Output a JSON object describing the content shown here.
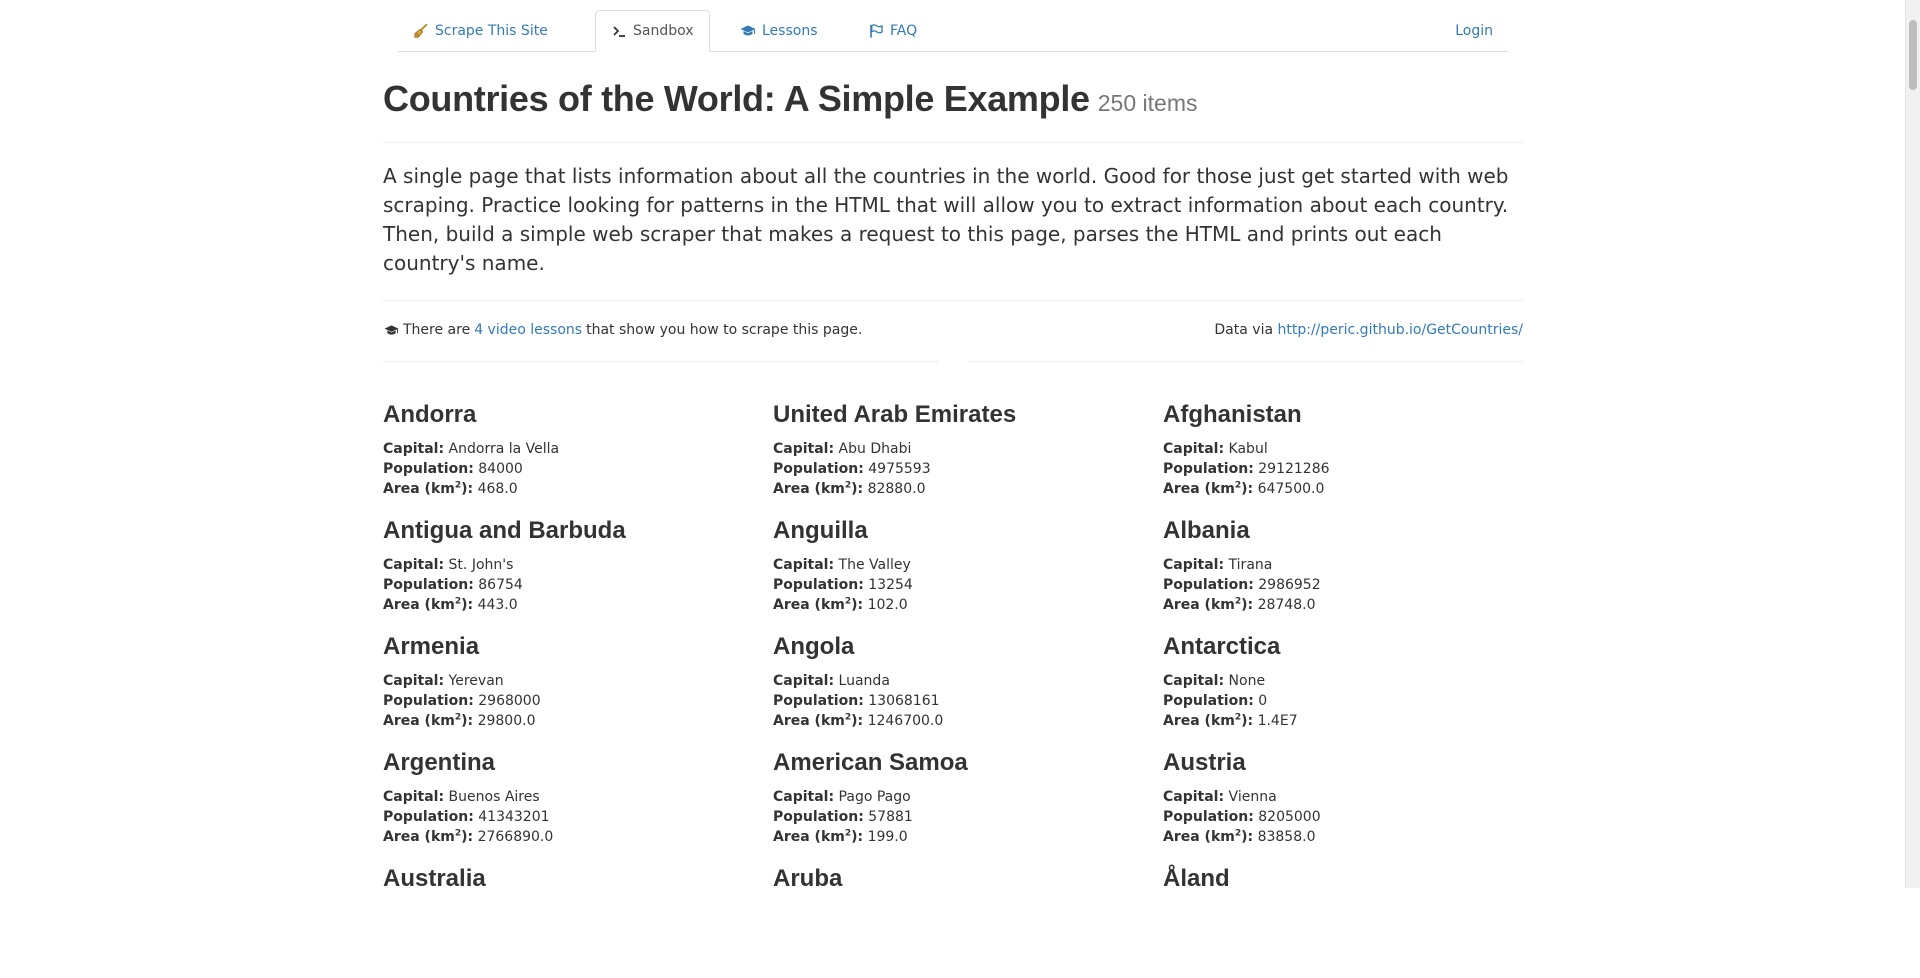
{
  "nav": {
    "tabs": [
      {
        "label": "Scrape This Site",
        "icon": "broom-icon"
      },
      {
        "label": "Sandbox",
        "icon": "terminal-icon"
      },
      {
        "label": "Lessons",
        "icon": "graduation-cap-icon"
      },
      {
        "label": "FAQ",
        "icon": "flag-icon"
      }
    ],
    "login": "Login"
  },
  "header": {
    "title": "Countries of the World: A Simple Example",
    "count": "250 items"
  },
  "lead": "A single page that lists information about all the countries in the world. Good for those just get started with web scraping. Practice looking for patterns in the HTML that will allow you to extract information about each country. Then, build a simple web scraper that makes a request to this page, parses the HTML and prints out each country's name.",
  "info": {
    "prefix": "There are",
    "link": "4 video lessons",
    "suffix": "that show you how to scrape this page.",
    "data_via": "Data via",
    "source_url": "http://peric.github.io/GetCountries/"
  },
  "labels": {
    "capital": "Capital:",
    "population": "Population:",
    "area_prefix": "Area (km",
    "area_sup": "2",
    "area_suffix": "):"
  },
  "countries": [
    {
      "name": "Andorra",
      "capital": "Andorra la Vella",
      "population": "84000",
      "area": "468.0"
    },
    {
      "name": "United Arab Emirates",
      "capital": "Abu Dhabi",
      "population": "4975593",
      "area": "82880.0"
    },
    {
      "name": "Afghanistan",
      "capital": "Kabul",
      "population": "29121286",
      "area": "647500.0"
    },
    {
      "name": "Antigua and Barbuda",
      "capital": "St. John's",
      "population": "86754",
      "area": "443.0"
    },
    {
      "name": "Anguilla",
      "capital": "The Valley",
      "population": "13254",
      "area": "102.0"
    },
    {
      "name": "Albania",
      "capital": "Tirana",
      "population": "2986952",
      "area": "28748.0"
    },
    {
      "name": "Armenia",
      "capital": "Yerevan",
      "population": "2968000",
      "area": "29800.0"
    },
    {
      "name": "Angola",
      "capital": "Luanda",
      "population": "13068161",
      "area": "1246700.0"
    },
    {
      "name": "Antarctica",
      "capital": "None",
      "population": "0",
      "area": "1.4E7"
    },
    {
      "name": "Argentina",
      "capital": "Buenos Aires",
      "population": "41343201",
      "area": "2766890.0"
    },
    {
      "name": "American Samoa",
      "capital": "Pago Pago",
      "population": "57881",
      "area": "199.0"
    },
    {
      "name": "Austria",
      "capital": "Vienna",
      "population": "8205000",
      "area": "83858.0"
    },
    {
      "name": "Australia"
    },
    {
      "name": "Aruba"
    },
    {
      "name": "Åland"
    }
  ]
}
